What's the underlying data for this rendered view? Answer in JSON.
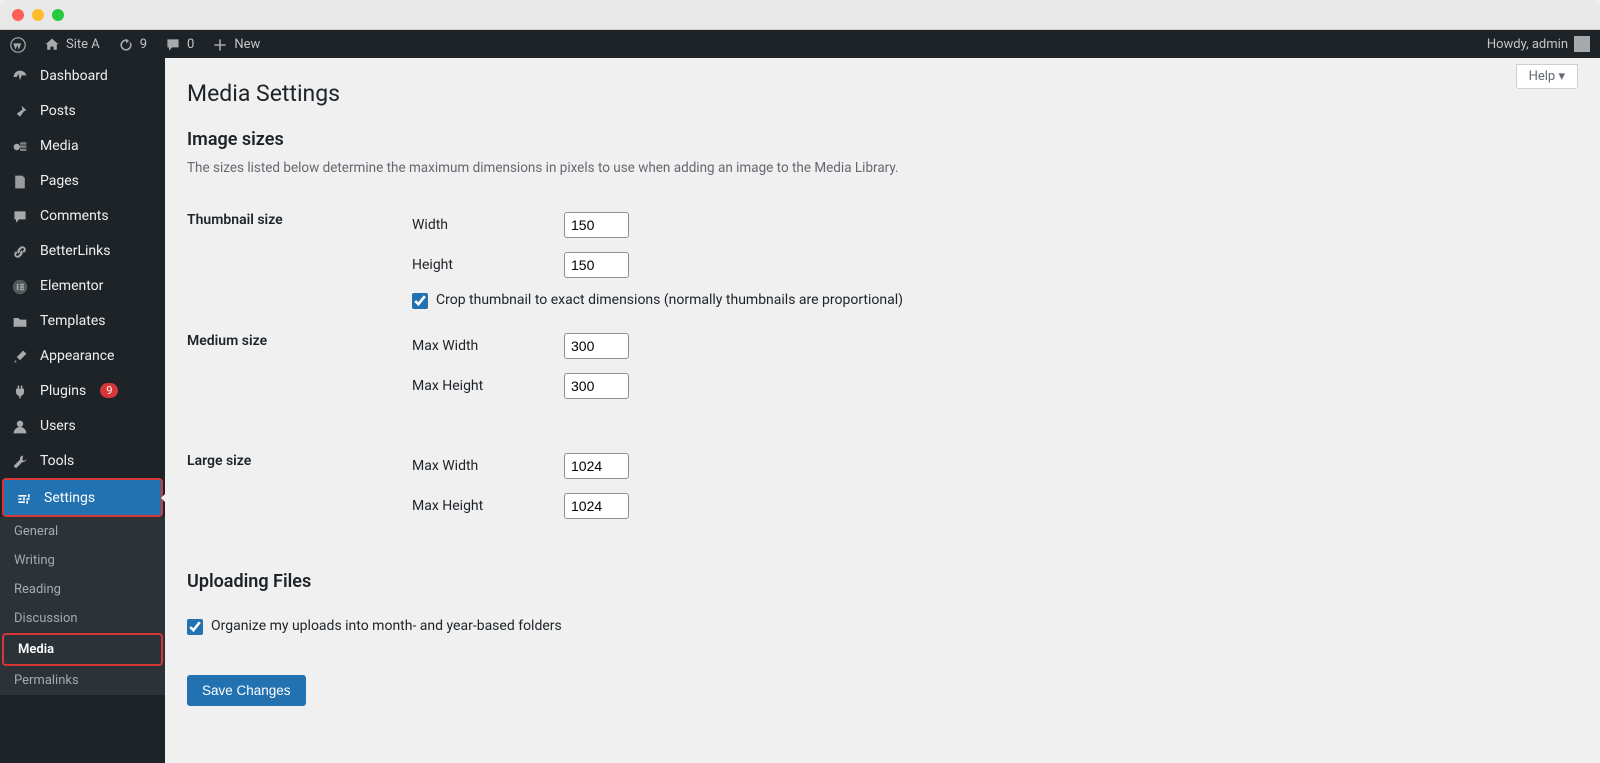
{
  "chrome": {},
  "adminbar": {
    "site_name": "Site A",
    "updates_count": "9",
    "comments_count": "0",
    "new_label": "New",
    "howdy": "Howdy, admin"
  },
  "sidebar": {
    "items": [
      {
        "label": "Dashboard"
      },
      {
        "label": "Posts"
      },
      {
        "label": "Media"
      },
      {
        "label": "Pages"
      },
      {
        "label": "Comments"
      },
      {
        "label": "BetterLinks"
      },
      {
        "label": "Elementor"
      },
      {
        "label": "Templates"
      },
      {
        "label": "Appearance"
      },
      {
        "label": "Plugins",
        "badge": "9"
      },
      {
        "label": "Users"
      },
      {
        "label": "Tools"
      },
      {
        "label": "Settings"
      }
    ],
    "submenu": [
      {
        "label": "General"
      },
      {
        "label": "Writing"
      },
      {
        "label": "Reading"
      },
      {
        "label": "Discussion"
      },
      {
        "label": "Media"
      },
      {
        "label": "Permalinks"
      }
    ]
  },
  "content": {
    "help_label": "Help",
    "page_title": "Media Settings",
    "section_image_sizes": "Image sizes",
    "image_sizes_desc": "The sizes listed below determine the maximum dimensions in pixels to use when adding an image to the Media Library.",
    "thumb": {
      "group_label": "Thumbnail size",
      "width_label": "Width",
      "height_label": "Height",
      "width_val": "150",
      "height_val": "150",
      "crop_label": "Crop thumbnail to exact dimensions (normally thumbnails are proportional)"
    },
    "medium": {
      "group_label": "Medium size",
      "width_label": "Max Width",
      "height_label": "Max Height",
      "width_val": "300",
      "height_val": "300"
    },
    "large": {
      "group_label": "Large size",
      "width_label": "Max Width",
      "height_label": "Max Height",
      "width_val": "1024",
      "height_val": "1024"
    },
    "section_uploading": "Uploading Files",
    "organize_label": "Organize my uploads into month- and year-based folders",
    "save_label": "Save Changes"
  }
}
